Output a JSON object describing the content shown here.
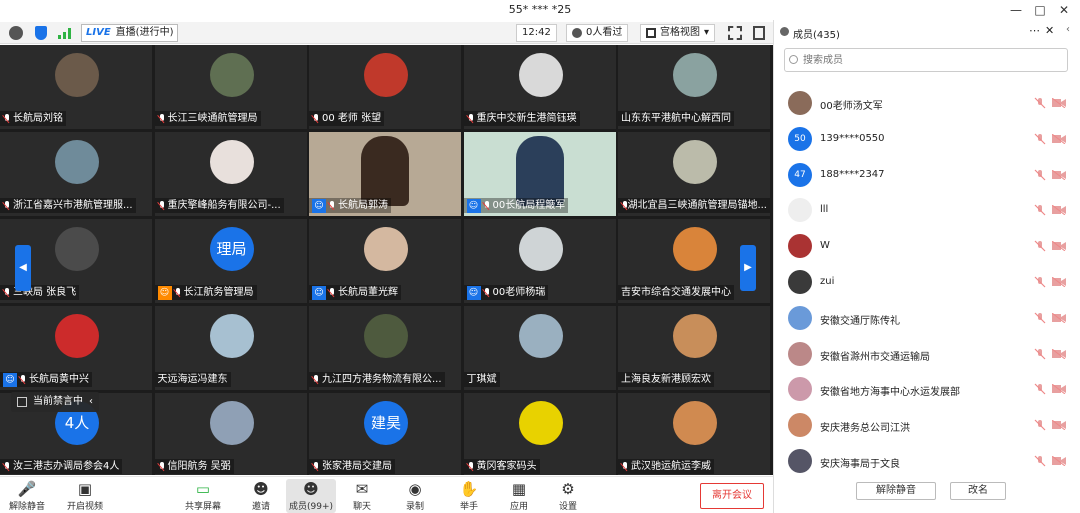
{
  "window": {
    "title": "55* *** *25"
  },
  "toolbar": {
    "live_label": "LIVE",
    "live_status": "直播(进行中)",
    "timer": "12:42",
    "viewers": "0人看过",
    "view_mode": "宫格视图"
  },
  "grid": {
    "tiles": [
      {
        "name": "长航局刘铭"
      },
      {
        "name": "长江三峡通航管理局"
      },
      {
        "name": "00 老师 张望"
      },
      {
        "name": "重庆中交新生港简钰瑛"
      },
      {
        "name": "山东东平港航中心解西同"
      },
      {
        "name": "浙江省嘉兴市港航管理服..."
      },
      {
        "name": "重庆擎峰船务有限公司-..."
      },
      {
        "name": "长航局郭涛"
      },
      {
        "name": "00长航局程簸军"
      },
      {
        "name": "湖北宜昌三峡通航管理局锚地..."
      },
      {
        "name": "三峡局 张良飞"
      },
      {
        "name": "长江航务管理局",
        "avatar_text": "理局"
      },
      {
        "name": "长航局董光辉"
      },
      {
        "name": "00老师杨瑞"
      },
      {
        "name": "吉安市综合交通发展中心"
      },
      {
        "name": "长航局黄中兴"
      },
      {
        "name": "天远海运冯建东"
      },
      {
        "name": "九江四方港务物流有限公..."
      },
      {
        "name": "丁琪斌"
      },
      {
        "name": "上海良友新港顾宏欢"
      },
      {
        "name": "汝三港志办调局参会4人",
        "avatar_text": "4人"
      },
      {
        "name": "信阳航务 吴弼"
      },
      {
        "name": "张家港局交建局",
        "avatar_text": "建昊"
      },
      {
        "name": "黄冈客家码头"
      },
      {
        "name": "武汉驰运航运李威"
      }
    ],
    "muted_tag": "当前禁言中"
  },
  "bottom": {
    "unmute": "解除静音",
    "video": "开启视频",
    "share": "共享屏幕",
    "invite": "邀请",
    "members": "成员(99+)",
    "chat": "聊天",
    "record": "录制",
    "raise": "举手",
    "apps": "应用",
    "settings": "设置",
    "leave": "离开会议"
  },
  "panel": {
    "title": "成员(435)",
    "search_placeholder": "搜索成员",
    "members": [
      {
        "name": "00老师汤文军"
      },
      {
        "name": "139****0550",
        "avatar_text": "50"
      },
      {
        "name": "188****2347",
        "avatar_text": "47"
      },
      {
        "name": "lll"
      },
      {
        "name": "W"
      },
      {
        "name": "zui"
      },
      {
        "name": "安徽交通厅陈传礼"
      },
      {
        "name": "安徽省滁州市交通运输局"
      },
      {
        "name": "安徽省地方海事中心水运发展部"
      },
      {
        "name": "安庆港务总公司江洪"
      },
      {
        "name": "安庆海事局于文良"
      }
    ],
    "unmute_all": "解除静音",
    "rename": "改名"
  },
  "colors": {
    "accent": "#1a73e8",
    "danger": "#e53935",
    "grid_bg": "#1c1c1c"
  }
}
